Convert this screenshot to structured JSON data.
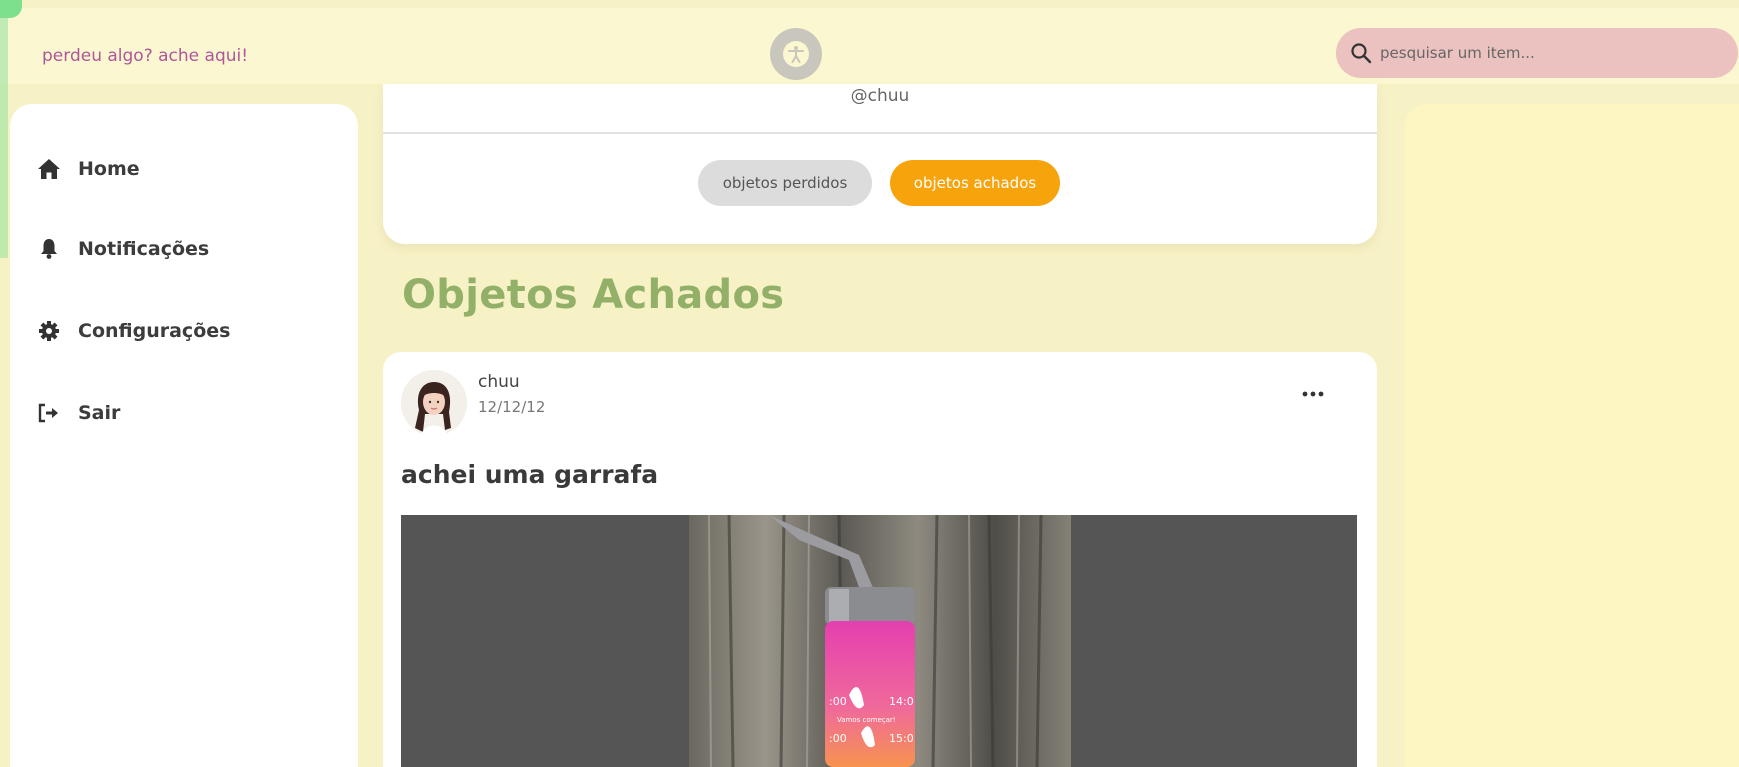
{
  "app": {
    "tagline": "perdeu algo? ache aqui!"
  },
  "search": {
    "placeholder": "pesquisar um item..."
  },
  "sidebar": {
    "items": [
      {
        "label": "Home",
        "icon": "home-icon"
      },
      {
        "label": "Notificações",
        "icon": "bell-icon"
      },
      {
        "label": "Configurações",
        "icon": "gear-icon"
      },
      {
        "label": "Sair",
        "icon": "logout-icon"
      }
    ]
  },
  "profile": {
    "handle": "@chuu",
    "tabs": [
      {
        "label": "objetos perdidos",
        "active": false
      },
      {
        "label": "objetos achados",
        "active": true
      }
    ]
  },
  "section": {
    "title": "Objetos Achados"
  },
  "post": {
    "user": "chuu",
    "date": "12/12/12",
    "title": "achei uma garrafa",
    "image_alt": "pink water bottle on wooden background"
  },
  "colors": {
    "background": "#f7f1c6",
    "accent_orange": "#f7a30c",
    "title_green": "#93b068",
    "brand_pink": "#b0569a",
    "search_pink": "#ebc2c0"
  }
}
